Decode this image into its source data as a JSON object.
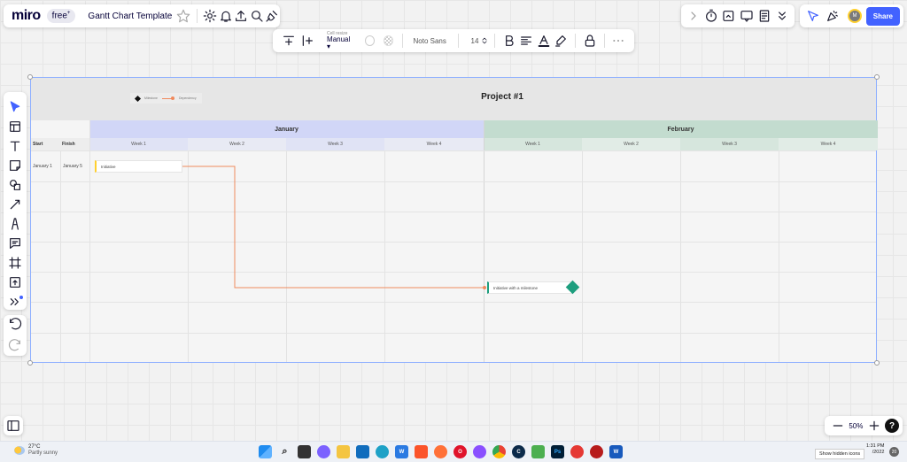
{
  "app": {
    "logo": "miro",
    "plan_badge": "free",
    "board_title": "Gantt Chart Template"
  },
  "collab": {
    "share_label": "Share",
    "avatar_initials": "M"
  },
  "context_toolbar": {
    "cell_resize_label": "Cell resize",
    "cell_resize_value": "Manual",
    "font_name": "Noto Sans",
    "font_size": "14"
  },
  "zoom": {
    "value": "50%",
    "help": "?"
  },
  "gantt": {
    "title": "Project #1",
    "legend": {
      "milestone": "Milestone",
      "dependency": "Dependency"
    },
    "columns": {
      "start": "Start",
      "finish": "Finish"
    },
    "months": [
      "January",
      "February"
    ],
    "weeks": [
      "Week 1",
      "Week 2",
      "Week 3",
      "Week 4",
      "Week 1",
      "Week 2",
      "Week 3",
      "Week 4"
    ],
    "rows": [
      {
        "start": "January 1",
        "finish": "January 5"
      }
    ],
    "tasks": [
      {
        "label": "Initiative",
        "accent": "#ffd02f"
      },
      {
        "label": "Initiative with a milestone",
        "accent": "#1e9e7e"
      }
    ],
    "colors": {
      "january": "#d1d6f7",
      "february": "#c3dccf",
      "dependency": "#f08a5d",
      "milestone": "#1e9e7e"
    }
  },
  "taskbar": {
    "weather_temp": "27°C",
    "weather_desc": "Partly sunny",
    "tray_tip": "Show hidden icons",
    "time": "1:31 PM",
    "date": "/2022",
    "notifications": "20"
  }
}
